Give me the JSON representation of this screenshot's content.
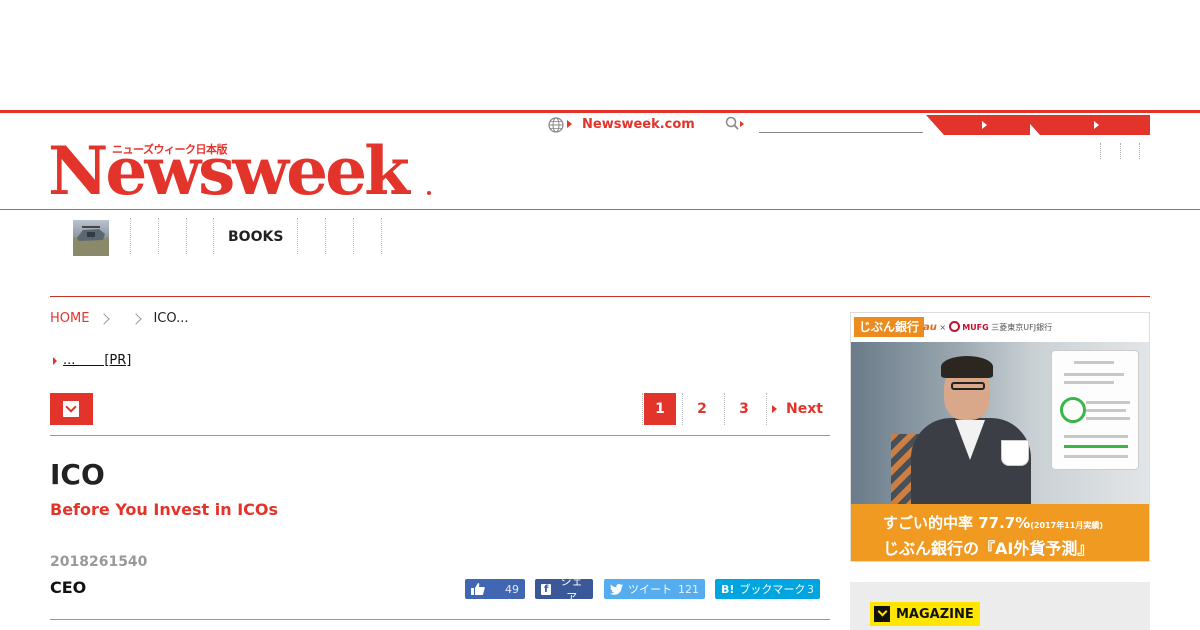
{
  "header": {
    "logo_text": "Newsweek",
    "logo_jp": "ニューズウィーク日本版",
    "global_link": "Newsweek.com",
    "search_placeholder": "",
    "accent_color": "#e3342c"
  },
  "nav": {
    "books_label": "BOOKS"
  },
  "breadcrumb": {
    "home": "HOME",
    "current": "ICO..."
  },
  "pr": {
    "link_text": "...       [PR]"
  },
  "pager": {
    "pages": [
      "1",
      "2",
      "3"
    ],
    "active": "1",
    "next": "Next"
  },
  "article": {
    "title": "ICO",
    "subtitle": "Before You Invest in ICOs",
    "date": "2018261540",
    "author": "CEO"
  },
  "share": {
    "like_count": "49",
    "fb_label": "シェア",
    "tweet_label": "ツイート",
    "tweet_count": "121",
    "hatena_label": "ブックマーク",
    "hatena_icon": "B!",
    "hatena_count": "3"
  },
  "ad": {
    "brand": "じぶん銀行",
    "partner_au": "au",
    "partner_x": "×",
    "partner_mufg": "MUFG",
    "partner_bank": "三菱東京UFJ銀行",
    "line1": "すごい的中率 77.7%",
    "line1_note": "(2017年11月実績)",
    "line2": "じぶん銀行の『AI外貨予測』"
  },
  "sidebar": {
    "magazine_label": "MAGAZINE"
  }
}
